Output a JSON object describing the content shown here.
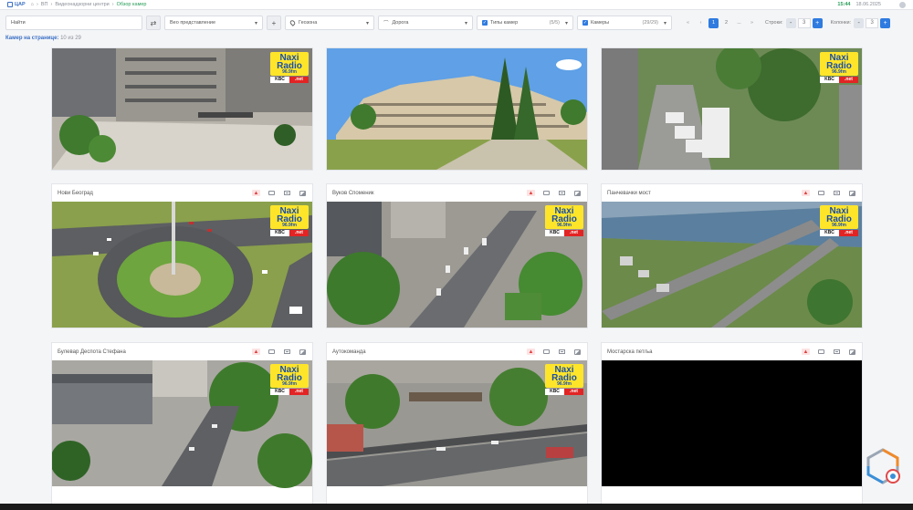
{
  "topbar": {
    "logo": "ЦАР",
    "crumbs": [
      "",
      "ВП",
      "Видеонадзорни центри"
    ],
    "crumb_active": "Обзор камер",
    "time": "15:44",
    "date": "18.06.2025"
  },
  "filters": {
    "search_placeholder": "Найти",
    "view_label": "Вео представление",
    "geo_label": "Геозона",
    "road_label": "Дорога",
    "types_label": "Типы камер",
    "types_count": "(5/5)",
    "cameras_label": "Камеры",
    "cameras_count": "(29/29)"
  },
  "pagination": {
    "pages": [
      "1",
      "2",
      "...",
      "»"
    ],
    "current": "1",
    "rows_label": "Строки:",
    "rows_value": "3",
    "cols_label": "Колонки:",
    "cols_value": "3"
  },
  "per_page": {
    "label": "Камер на странице:",
    "value": "10 из 29"
  },
  "overlay": {
    "naxi": "Naxi",
    "radio": "Radio",
    "freq": "96.9fm",
    "kbc": "KBC",
    "net": ".net"
  },
  "cameras": [
    {
      "title": "",
      "feed": "city-square",
      "badge": true
    },
    {
      "title": "",
      "feed": "building-trees",
      "badge": false
    },
    {
      "title": "",
      "feed": "tents-street",
      "badge": true
    },
    {
      "title": "Нови Београд",
      "feed": "roundabout",
      "badge": true
    },
    {
      "title": "Вуков Споменик",
      "feed": "boulevard",
      "badge": true
    },
    {
      "title": "Панчевачки мост",
      "feed": "bridge-river",
      "badge": true
    },
    {
      "title": "Булевар Деспота Стефана",
      "feed": "crossroad-building",
      "badge": true
    },
    {
      "title": "Аутокоманда",
      "feed": "highway",
      "badge": true
    },
    {
      "title": "Мостарска петља",
      "feed": "offline",
      "badge": false
    }
  ]
}
